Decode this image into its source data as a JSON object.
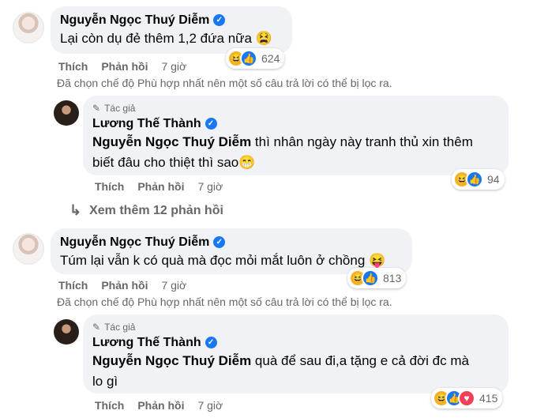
{
  "comments": [
    {
      "author": "Nguyễn Ngọc Thuý Diễm",
      "text": "Lại còn dụ đẻ thêm 1,2 đứa nữa 😫",
      "actions": {
        "like": "Thích",
        "reply": "Phản hồi",
        "time": "7 giờ"
      },
      "reactions": {
        "count": "624",
        "types": [
          "haha",
          "like"
        ]
      },
      "notice": "Đã chọn chế độ Phù hợp nhất nên một số câu trả lời có thể bị lọc ra.",
      "reply": {
        "role": "Tác giả",
        "author": "Lương Thế Thành",
        "mention": "Nguyễn Ngọc Thuý Diễm",
        "text_line1": "thì nhân ngày này tranh thủ xin thêm",
        "text_line2": "biết đâu cho thiệt thì sao😁",
        "actions": {
          "like": "Thích",
          "reply": "Phản hồi",
          "time": "7 giờ"
        },
        "reactions": {
          "count": "94",
          "types": [
            "haha",
            "like"
          ]
        }
      },
      "more_replies": "Xem thêm 12 phản hồi"
    },
    {
      "author": "Nguyễn Ngọc Thuý Diễm",
      "text": "Túm lại vẫn k có quà mà đọc mỏi mắt luôn ở chồng 😝",
      "actions": {
        "like": "Thích",
        "reply": "Phản hồi",
        "time": "7 giờ"
      },
      "reactions": {
        "count": "813",
        "types": [
          "haha",
          "like"
        ]
      },
      "notice": "Đã chọn chế độ Phù hợp nhất nên một số câu trả lời có thể bị lọc ra.",
      "reply": {
        "role": "Tác giả",
        "author": "Lương Thế Thành",
        "mention": "Nguyễn Ngọc Thuý Diễm",
        "text_line1": "quà để sau đi,a tặng e cả đời đc mà",
        "text_line2": "lo gì",
        "actions": {
          "like": "Thích",
          "reply": "Phản hồi",
          "time": "7 giờ"
        },
        "reactions": {
          "count": "415",
          "types": [
            "haha",
            "like",
            "love"
          ]
        }
      }
    }
  ],
  "icons": {
    "verified": "verified-badge-icon",
    "author_role": "pen-icon",
    "more_replies": "reply-arrow-icon"
  },
  "colors": {
    "bubble": "#f0f2f5",
    "meta": "#65676b",
    "verified": "#1877f2",
    "like": "#1877f2",
    "haha": "#f7b125",
    "love": "#f33e58"
  }
}
